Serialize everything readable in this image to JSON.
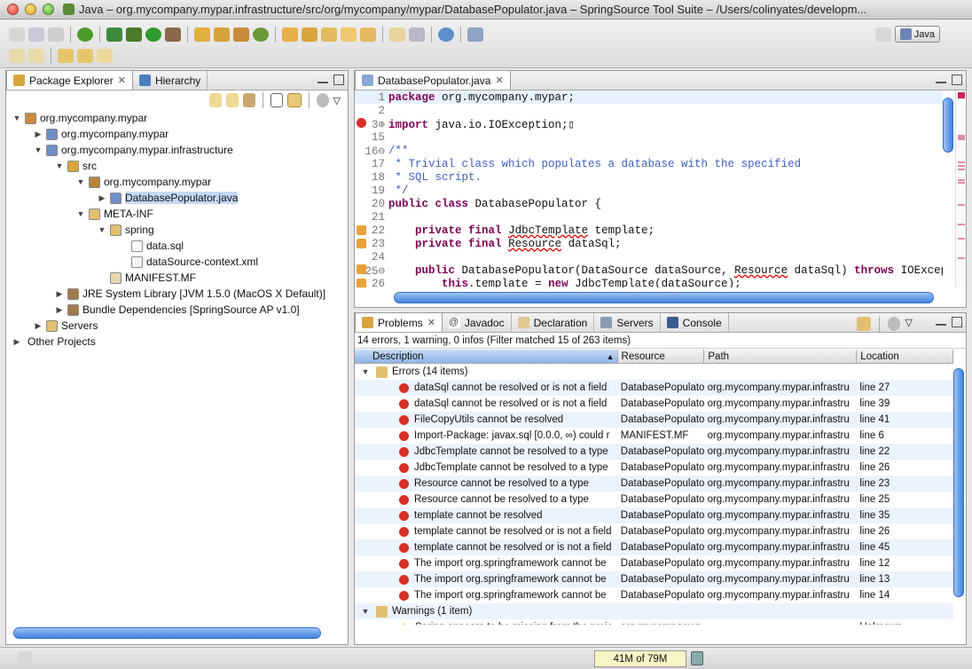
{
  "window": {
    "title": "Java – org.mycompany.mypar.infrastructure/src/org/mycompany/mypar/DatabasePopulator.java – SpringSource Tool Suite – /Users/colinyates/developm..."
  },
  "toolbar": {
    "perspective_label": "Java"
  },
  "package_explorer": {
    "tabs": [
      {
        "label": "Package Explorer"
      },
      {
        "label": "Hierarchy"
      }
    ],
    "tree": [
      {
        "label": "org.mycompany.mypar",
        "icon": "project-icon",
        "twisty": "▼",
        "indent": 0
      },
      {
        "label": "org.mycompany.mypar",
        "icon": "bundle-project-icon",
        "twisty": "▶",
        "indent": 1
      },
      {
        "label": "org.mycompany.mypar.infrastructure",
        "icon": "bundle-project-icon",
        "twisty": "▼",
        "indent": 1
      },
      {
        "label": "src",
        "icon": "source-folder-icon",
        "twisty": "▼",
        "indent": 2
      },
      {
        "label": "org.mycompany.mypar",
        "icon": "package-icon",
        "twisty": "▼",
        "indent": 3
      },
      {
        "label": "DatabasePopulator.java",
        "icon": "java-file-error-icon",
        "twisty": "▶",
        "indent": 4,
        "selected": true
      },
      {
        "label": "META-INF",
        "icon": "folder-icon",
        "twisty": "▼",
        "indent": 3
      },
      {
        "label": "spring",
        "icon": "folder-icon",
        "twisty": "▼",
        "indent": 4
      },
      {
        "label": "data.sql",
        "icon": "file-icon",
        "twisty": "",
        "indent": 5
      },
      {
        "label": "dataSource-context.xml",
        "icon": "xml-file-icon",
        "twisty": "",
        "indent": 5
      },
      {
        "label": "MANIFEST.MF",
        "icon": "manifest-file-icon",
        "twisty": "",
        "indent": 4
      },
      {
        "label": "JRE System Library [JVM 1.5.0 (MacOS X Default)]",
        "icon": "library-icon",
        "twisty": "▶",
        "indent": 2
      },
      {
        "label": "Bundle Dependencies [SpringSource AP v1.0]",
        "icon": "library-icon",
        "twisty": "▶",
        "indent": 2
      },
      {
        "label": "Servers",
        "icon": "folder-icon",
        "twisty": "▶",
        "indent": 1
      },
      {
        "label": "Other Projects",
        "icon": "",
        "twisty": "▶",
        "indent": 0
      }
    ]
  },
  "editor": {
    "tab_label": "DatabasePopulator.java",
    "lines": [
      {
        "num": "1",
        "marker": "",
        "html": "<span class=\"kw\">package</span> org.mycompany.mypar;",
        "highlight": true
      },
      {
        "num": "2",
        "marker": "",
        "html": ""
      },
      {
        "num": "3⊕",
        "marker": "error",
        "html": "<span class=\"kw\">import</span> java.io.IOException;▯"
      },
      {
        "num": "15",
        "marker": "",
        "html": ""
      },
      {
        "num": "16⊖",
        "marker": "",
        "html": "<span class=\"cm\">/**</span>"
      },
      {
        "num": "17",
        "marker": "",
        "html": "<span class=\"cm\"> * Trivial class which populates a database with the specified</span>"
      },
      {
        "num": "18",
        "marker": "",
        "html": "<span class=\"cm\"> * SQL script.</span>"
      },
      {
        "num": "19",
        "marker": "",
        "html": "<span class=\"cm\"> */</span>"
      },
      {
        "num": "20",
        "marker": "",
        "html": "<span class=\"kw\">public class</span> DatabasePopulator {"
      },
      {
        "num": "21",
        "marker": "",
        "html": ""
      },
      {
        "num": "22",
        "marker": "warn",
        "html": "    <span class=\"kw\">private final</span> <span class=\"err\">JdbcTemplate</span> template;"
      },
      {
        "num": "23",
        "marker": "warn",
        "html": "    <span class=\"kw\">private final</span> <span class=\"err\">Resource</span> dataSql;"
      },
      {
        "num": "24",
        "marker": "",
        "html": ""
      },
      {
        "num": "25⊖",
        "marker": "warn",
        "html": "    <span class=\"kw\">public</span> DatabasePopulator(DataSource dataSource, <span class=\"err\">Resource</span> dataSql) <span class=\"kw\">throws</span> IOException"
      },
      {
        "num": "26",
        "marker": "warn",
        "html": "        <span class=\"kw\">this</span>.<span class=\"err\">template</span> = <span class=\"kw\">new</span> <span class=\"err\">JdbcTemplate</span>(dataSource);"
      }
    ]
  },
  "problems": {
    "tabs": [
      {
        "label": "Problems",
        "icon": "problems-icon",
        "active": true
      },
      {
        "label": "Javadoc",
        "icon": "javadoc-icon"
      },
      {
        "label": "Declaration",
        "icon": "declaration-icon"
      },
      {
        "label": "Servers",
        "icon": "servers-icon"
      },
      {
        "label": "Console",
        "icon": "console-icon"
      }
    ],
    "summary": "14 errors, 1 warning, 0 infos (Filter matched 15 of 263 items)",
    "columns": [
      "Description",
      "Resource",
      "Path",
      "Location"
    ],
    "groups": [
      {
        "label": "Errors (14 items)",
        "type": "error",
        "items": [
          {
            "description": "dataSql cannot be resolved or is not a field",
            "resource": "DatabasePopulato",
            "path": "org.mycompany.mypar.infrastru",
            "location": "line 27"
          },
          {
            "description": "dataSql cannot be resolved or is not a field",
            "resource": "DatabasePopulato",
            "path": "org.mycompany.mypar.infrastru",
            "location": "line 39"
          },
          {
            "description": "FileCopyUtils cannot be resolved",
            "resource": "DatabasePopulato",
            "path": "org.mycompany.mypar.infrastru",
            "location": "line 41"
          },
          {
            "description": "Import-Package: javax.sql [0.0.0, ∞) could r",
            "resource": "MANIFEST.MF",
            "path": "org.mycompany.mypar.infrastru",
            "location": "line 6"
          },
          {
            "description": "JdbcTemplate cannot be resolved to a type",
            "resource": "DatabasePopulato",
            "path": "org.mycompany.mypar.infrastru",
            "location": "line 22"
          },
          {
            "description": "JdbcTemplate cannot be resolved to a type",
            "resource": "DatabasePopulato",
            "path": "org.mycompany.mypar.infrastru",
            "location": "line 26"
          },
          {
            "description": "Resource cannot be resolved to a type",
            "resource": "DatabasePopulato",
            "path": "org.mycompany.mypar.infrastru",
            "location": "line 23"
          },
          {
            "description": "Resource cannot be resolved to a type",
            "resource": "DatabasePopulato",
            "path": "org.mycompany.mypar.infrastru",
            "location": "line 25"
          },
          {
            "description": "template cannot be resolved",
            "resource": "DatabasePopulato",
            "path": "org.mycompany.mypar.infrastru",
            "location": "line 35"
          },
          {
            "description": "template cannot be resolved or is not a field",
            "resource": "DatabasePopulato",
            "path": "org.mycompany.mypar.infrastru",
            "location": "line 26"
          },
          {
            "description": "template cannot be resolved or is not a field",
            "resource": "DatabasePopulato",
            "path": "org.mycompany.mypar.infrastru",
            "location": "line 45"
          },
          {
            "description": "The import org.springframework cannot be",
            "resource": "DatabasePopulato",
            "path": "org.mycompany.mypar.infrastru",
            "location": "line 12"
          },
          {
            "description": "The import org.springframework cannot be",
            "resource": "DatabasePopulato",
            "path": "org.mycompany.mypar.infrastru",
            "location": "line 13"
          },
          {
            "description": "The import org.springframework cannot be",
            "resource": "DatabasePopulato",
            "path": "org.mycompany.mypar.infrastru",
            "location": "line 14"
          }
        ]
      },
      {
        "label": "Warnings (1 item)",
        "type": "warning",
        "items": [
          {
            "description": "Spring appears to be missing from the proje",
            "resource": "org.mycompany.n",
            "path": "",
            "location": "Unknown"
          }
        ]
      }
    ]
  },
  "statusbar": {
    "heap_label": "41M of 79M"
  },
  "colors": {
    "selection": "#c5d9f5",
    "error": "#d93025",
    "keyword": "#7f0055",
    "comment": "#3f5fbf",
    "scrollbar": "#3f82de"
  }
}
